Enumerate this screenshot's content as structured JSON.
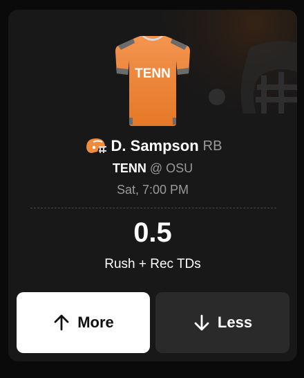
{
  "player": {
    "name": "D. Sampson",
    "position": "RB",
    "jersey_text": "TENN",
    "helmet_icon": "football-helmet-icon"
  },
  "matchup": {
    "team": "TENN",
    "separator": "@",
    "opponent": "OSU"
  },
  "game_time": "Sat, 7:00 PM",
  "projection": {
    "line": "0.5",
    "stat": "Rush + Rec TDs"
  },
  "actions": {
    "more_label": "More",
    "less_label": "Less",
    "more_icon": "arrow-up-icon",
    "less_icon": "arrow-down-icon"
  },
  "colors": {
    "team_orange": "#f08a3c",
    "card_bg": "#181818",
    "more_bg": "#ffffff",
    "less_bg": "#2a2a2a"
  }
}
